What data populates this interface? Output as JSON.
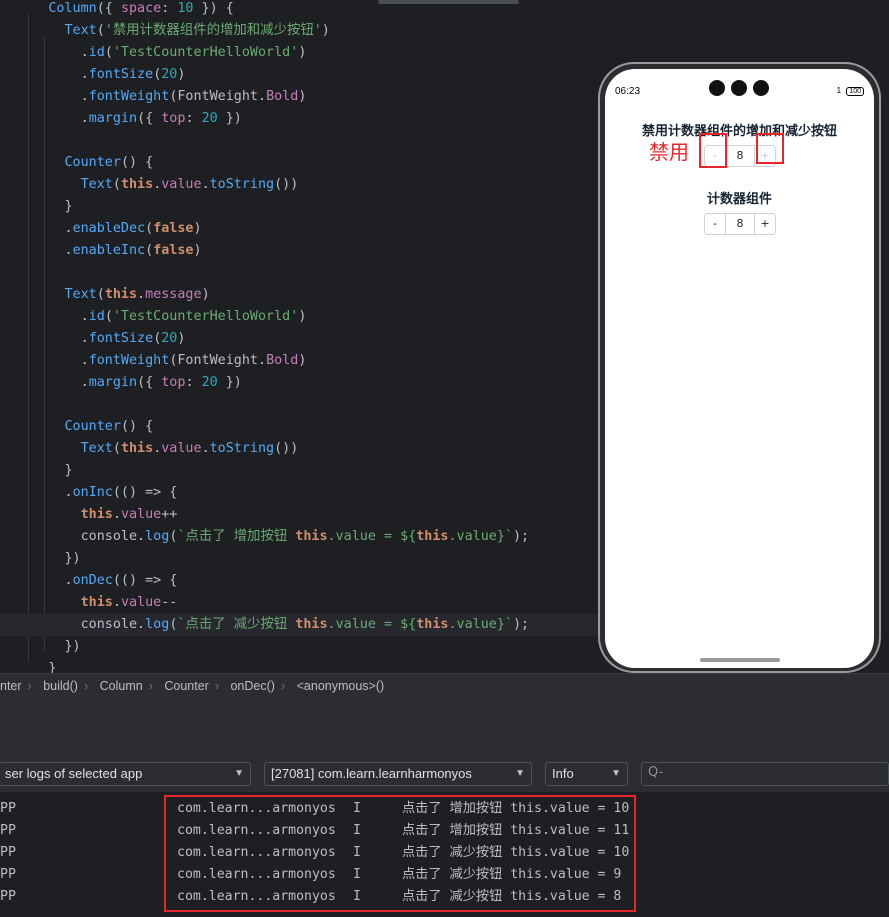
{
  "editor": {
    "lines": [
      {
        "indent": "  ",
        "tokens": [
          [
            "fn",
            "Column"
          ],
          [
            "punc",
            "({ "
          ],
          [
            "prop",
            "space"
          ],
          [
            "punc",
            ": "
          ],
          [
            "num",
            "10"
          ],
          [
            "punc",
            " }) {"
          ]
        ]
      },
      {
        "indent": "    ",
        "tokens": [
          [
            "fn",
            "Text"
          ],
          [
            "punc",
            "("
          ],
          [
            "str",
            "'禁用计数器组件的增加和减少按钮'"
          ],
          [
            "punc",
            ")"
          ]
        ]
      },
      {
        "indent": "      ",
        "tokens": [
          [
            "punc",
            "."
          ],
          [
            "fn",
            "id"
          ],
          [
            "punc",
            "("
          ],
          [
            "str",
            "'TestCounterHelloWorld'"
          ],
          [
            "punc",
            ")"
          ]
        ]
      },
      {
        "indent": "      ",
        "tokens": [
          [
            "punc",
            "."
          ],
          [
            "fn",
            "fontSize"
          ],
          [
            "punc",
            "("
          ],
          [
            "num",
            "20"
          ],
          [
            "punc",
            ")"
          ]
        ]
      },
      {
        "indent": "      ",
        "tokens": [
          [
            "punc",
            "."
          ],
          [
            "fn",
            "fontWeight"
          ],
          [
            "punc",
            "(FontWeight."
          ],
          [
            "prop",
            "Bold"
          ],
          [
            "punc",
            ")"
          ]
        ]
      },
      {
        "indent": "      ",
        "tokens": [
          [
            "punc",
            "."
          ],
          [
            "fn",
            "margin"
          ],
          [
            "punc",
            "({ "
          ],
          [
            "prop",
            "top"
          ],
          [
            "punc",
            ": "
          ],
          [
            "num",
            "20"
          ],
          [
            "punc",
            " })"
          ]
        ]
      },
      {
        "indent": "",
        "tokens": []
      },
      {
        "indent": "    ",
        "tokens": [
          [
            "fn",
            "Counter"
          ],
          [
            "punc",
            "() {"
          ]
        ]
      },
      {
        "indent": "      ",
        "tokens": [
          [
            "fn",
            "Text"
          ],
          [
            "punc",
            "("
          ],
          [
            "kw",
            "this"
          ],
          [
            "punc",
            "."
          ],
          [
            "prop",
            "value"
          ],
          [
            "punc",
            "."
          ],
          [
            "fn",
            "toString"
          ],
          [
            "punc",
            "())"
          ]
        ]
      },
      {
        "indent": "    ",
        "tokens": [
          [
            "punc",
            "}"
          ]
        ]
      },
      {
        "indent": "    ",
        "tokens": [
          [
            "punc",
            "."
          ],
          [
            "fn",
            "enableDec"
          ],
          [
            "punc",
            "("
          ],
          [
            "kw",
            "false"
          ],
          [
            "punc",
            ")"
          ]
        ]
      },
      {
        "indent": "    ",
        "tokens": [
          [
            "punc",
            "."
          ],
          [
            "fn",
            "enableInc"
          ],
          [
            "punc",
            "("
          ],
          [
            "kw",
            "false"
          ],
          [
            "punc",
            ")"
          ]
        ]
      },
      {
        "indent": "",
        "tokens": []
      },
      {
        "indent": "    ",
        "tokens": [
          [
            "fn",
            "Text"
          ],
          [
            "punc",
            "("
          ],
          [
            "kw",
            "this"
          ],
          [
            "punc",
            "."
          ],
          [
            "prop",
            "message"
          ],
          [
            "punc",
            ")"
          ]
        ]
      },
      {
        "indent": "      ",
        "tokens": [
          [
            "punc",
            "."
          ],
          [
            "fn",
            "id"
          ],
          [
            "punc",
            "("
          ],
          [
            "str",
            "'TestCounterHelloWorld'"
          ],
          [
            "punc",
            ")"
          ]
        ]
      },
      {
        "indent": "      ",
        "tokens": [
          [
            "punc",
            "."
          ],
          [
            "fn",
            "fontSize"
          ],
          [
            "punc",
            "("
          ],
          [
            "num",
            "20"
          ],
          [
            "punc",
            ")"
          ]
        ]
      },
      {
        "indent": "      ",
        "tokens": [
          [
            "punc",
            "."
          ],
          [
            "fn",
            "fontWeight"
          ],
          [
            "punc",
            "(FontWeight."
          ],
          [
            "prop",
            "Bold"
          ],
          [
            "punc",
            ")"
          ]
        ]
      },
      {
        "indent": "      ",
        "tokens": [
          [
            "punc",
            "."
          ],
          [
            "fn",
            "margin"
          ],
          [
            "punc",
            "({ "
          ],
          [
            "prop",
            "top"
          ],
          [
            "punc",
            ": "
          ],
          [
            "num",
            "20"
          ],
          [
            "punc",
            " })"
          ]
        ]
      },
      {
        "indent": "",
        "tokens": []
      },
      {
        "indent": "    ",
        "tokens": [
          [
            "fn",
            "Counter"
          ],
          [
            "punc",
            "() {"
          ]
        ]
      },
      {
        "indent": "      ",
        "tokens": [
          [
            "fn",
            "Text"
          ],
          [
            "punc",
            "("
          ],
          [
            "kw",
            "this"
          ],
          [
            "punc",
            "."
          ],
          [
            "prop",
            "value"
          ],
          [
            "punc",
            "."
          ],
          [
            "fn",
            "toString"
          ],
          [
            "punc",
            "())"
          ]
        ]
      },
      {
        "indent": "    ",
        "tokens": [
          [
            "punc",
            "}"
          ]
        ]
      },
      {
        "indent": "    ",
        "tokens": [
          [
            "punc",
            "."
          ],
          [
            "fn",
            "onInc"
          ],
          [
            "punc",
            "(() => {"
          ]
        ]
      },
      {
        "indent": "      ",
        "tokens": [
          [
            "kw",
            "this"
          ],
          [
            "punc",
            "."
          ],
          [
            "prop",
            "value"
          ],
          [
            "punc",
            "++"
          ]
        ]
      },
      {
        "indent": "      ",
        "tokens": [
          [
            "punc",
            "console."
          ],
          [
            "fn",
            "log"
          ],
          [
            "punc",
            "("
          ],
          [
            "str",
            "`点击了 增加按钮 "
          ],
          [
            "kw",
            "this"
          ],
          [
            "str",
            ".value = ${"
          ],
          [
            "kw",
            "this"
          ],
          [
            "str",
            ".value}`"
          ],
          [
            "punc",
            ");"
          ]
        ]
      },
      {
        "indent": "    ",
        "tokens": [
          [
            "punc",
            "})"
          ]
        ]
      },
      {
        "indent": "    ",
        "tokens": [
          [
            "punc",
            "."
          ],
          [
            "fn",
            "onDec"
          ],
          [
            "punc",
            "(() => {"
          ]
        ]
      },
      {
        "indent": "      ",
        "tokens": [
          [
            "kw",
            "this"
          ],
          [
            "punc",
            "."
          ],
          [
            "prop",
            "value"
          ],
          [
            "punc",
            "--"
          ]
        ]
      },
      {
        "indent": "      ",
        "tokens": [
          [
            "punc",
            "console."
          ],
          [
            "fn",
            "log"
          ],
          [
            "punc",
            "("
          ],
          [
            "str",
            "`点击了 减少按钮 "
          ],
          [
            "kw",
            "this"
          ],
          [
            "str",
            ".value = ${"
          ],
          [
            "kw",
            "this"
          ],
          [
            "str",
            ".value}`"
          ],
          [
            "punc",
            ");"
          ]
        ]
      },
      {
        "indent": "    ",
        "tokens": [
          [
            "punc",
            "})"
          ]
        ]
      },
      {
        "indent": "  ",
        "tokens": [
          [
            "punc",
            "}"
          ]
        ]
      }
    ]
  },
  "phone": {
    "time": "06:23",
    "battery": "100",
    "battery_icon": "1",
    "title1": "禁用计数器组件的增加和减少按钮",
    "counter1": {
      "dec": "-",
      "value": "8",
      "inc": "+"
    },
    "title2": "计数器组件",
    "counter2": {
      "dec": "-",
      "value": "8",
      "inc": "+"
    },
    "annotation": "禁用"
  },
  "breadcrumb": [
    "nter",
    "build()",
    "Column",
    "Counter",
    "onDec()",
    "<anonymous>()"
  ],
  "filters": {
    "log_source": "ser logs of selected app",
    "process": "[27081] com.learn.learnharmonyos",
    "level": "Info",
    "search_placeholder": "Q-"
  },
  "logs": [
    {
      "app": "PP",
      "pkg": "com.learn...armonyos",
      "level": "I",
      "msg": "点击了 增加按钮 this.value = 10"
    },
    {
      "app": "PP",
      "pkg": "com.learn...armonyos",
      "level": "I",
      "msg": "点击了 增加按钮 this.value = 11"
    },
    {
      "app": "PP",
      "pkg": "com.learn...armonyos",
      "level": "I",
      "msg": "点击了 减少按钮 this.value = 10"
    },
    {
      "app": "PP",
      "pkg": "com.learn...armonyos",
      "level": "I",
      "msg": "点击了 减少按钮 this.value = 9"
    },
    {
      "app": "PP",
      "pkg": "com.learn...armonyos",
      "level": "I",
      "msg": "点击了 减少按钮 this.value = 8"
    }
  ],
  "colors": {
    "annotation_red": "#e8262a",
    "editor_bg": "#1e1f22",
    "panel_bg": "#2b2d30"
  }
}
